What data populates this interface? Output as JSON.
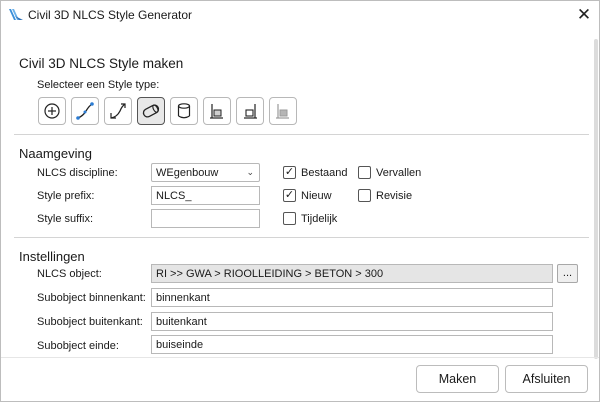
{
  "window": {
    "title": "Civil 3D NLCS Style Generator",
    "close_glyph": "✕"
  },
  "main": {
    "title": "Civil 3D NLCS Style maken",
    "style_type_label": "Selecteer een Style type:",
    "style_types": [
      {
        "icon": "point-icon",
        "selected": false
      },
      {
        "icon": "alignment-icon",
        "selected": false
      },
      {
        "icon": "profile-icon",
        "selected": false
      },
      {
        "icon": "pipe-icon",
        "selected": true
      },
      {
        "icon": "structure-icon",
        "selected": false
      },
      {
        "icon": "section-left-icon",
        "selected": false
      },
      {
        "icon": "section-right-icon",
        "selected": false
      },
      {
        "icon": "section-disabled-icon",
        "selected": false
      }
    ]
  },
  "naamgeving": {
    "title": "Naamgeving",
    "discipline_label": "NLCS discipline:",
    "discipline_value": "WEgenbouw",
    "prefix_label": "Style prefix:",
    "prefix_value": "NLCS_",
    "suffix_label": "Style suffix:",
    "suffix_value": "",
    "checkboxes": {
      "bestaand": {
        "label": "Bestaand",
        "checked": true
      },
      "nieuw": {
        "label": "Nieuw",
        "checked": true
      },
      "tijdelijk": {
        "label": "Tijdelijk",
        "checked": false
      },
      "vervallen": {
        "label": "Vervallen",
        "checked": false
      },
      "revisie": {
        "label": "Revisie",
        "checked": false
      }
    }
  },
  "instellingen": {
    "title": "Instellingen",
    "object_label": "NLCS object:",
    "object_value": "RI >> GWA > RIOOLLEIDING > BETON > 300",
    "browse_label": "...",
    "binnenkant_label": "Subobject binnenkant:",
    "binnenkant_value": "binnenkant",
    "buitenkant_label": "Subobject buitenkant:",
    "buitenkant_value": "buitenkant",
    "einde_label": "Subobject einde:",
    "einde_value": "buiseinde"
  },
  "footer": {
    "maken_label": "Maken",
    "afsluiten_label": "Afsluiten"
  },
  "colors": {
    "icon_blue": "#2b7cd3",
    "icon_dark": "#222222",
    "readonly_bg": "#e5e5e5"
  }
}
